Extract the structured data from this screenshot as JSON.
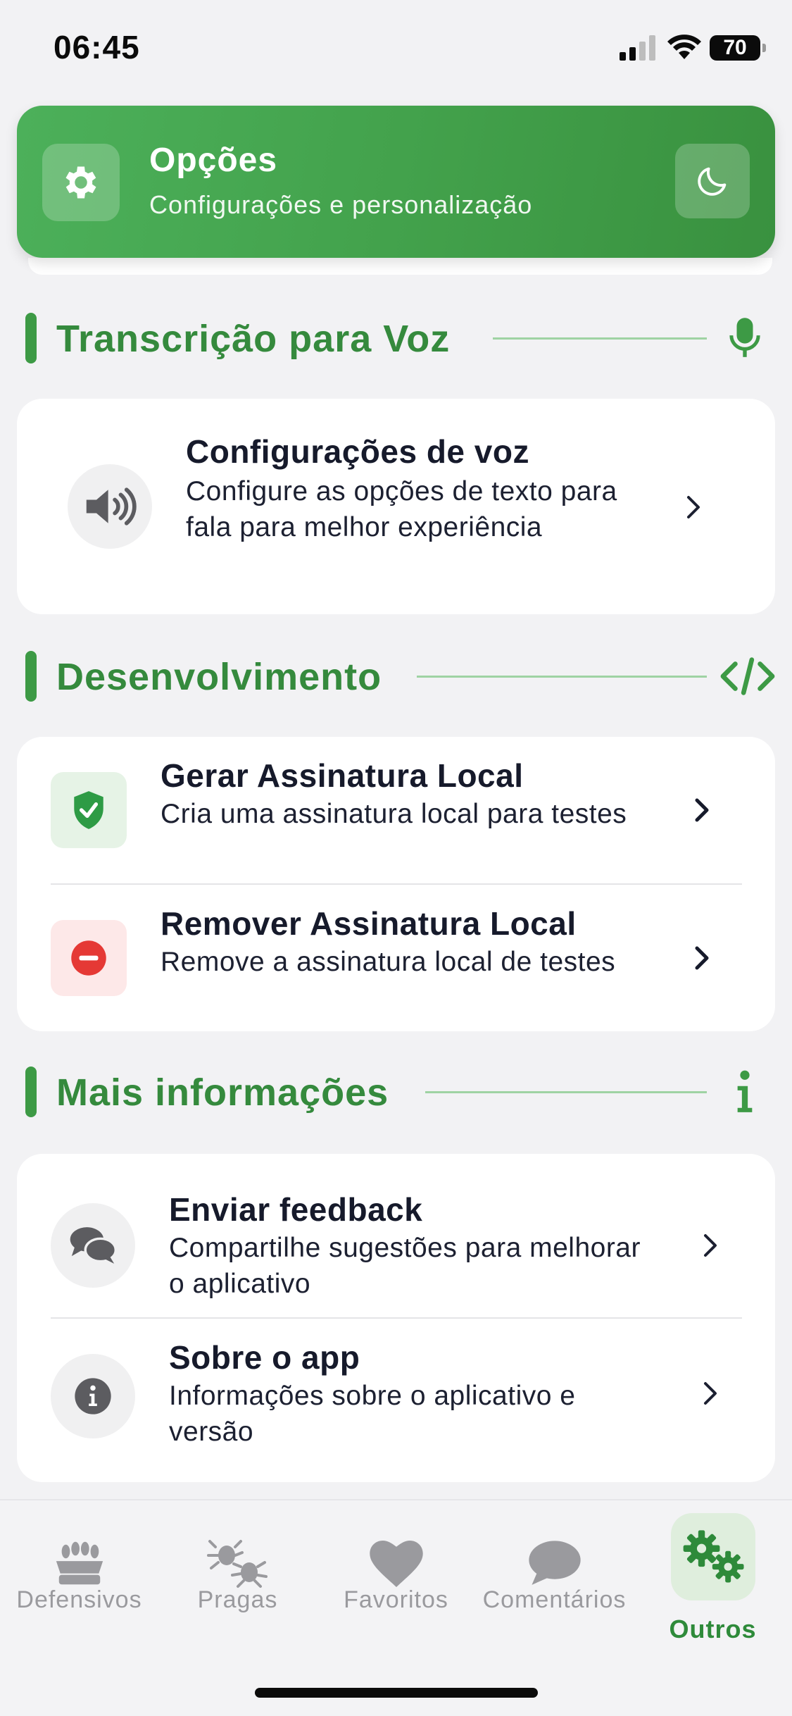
{
  "status_bar": {
    "time": "06:45",
    "battery": "70"
  },
  "header": {
    "title": "Opções",
    "subtitle": "Configurações e personalização"
  },
  "sections": {
    "voice": {
      "title": "Transcrição para Voz",
      "item": {
        "title": "Configurações de voz",
        "description": "Configure as opções de texto para fala para melhor experiência"
      }
    },
    "dev": {
      "title": "Desenvolvimento",
      "items": [
        {
          "title": "Gerar Assinatura Local",
          "description": "Cria uma assinatura local para testes"
        },
        {
          "title": "Remover Assinatura Local",
          "description": "Remove a assinatura local de testes"
        }
      ]
    },
    "info": {
      "title": "Mais informações",
      "items": [
        {
          "title": "Enviar feedback",
          "description": "Compartilhe sugestões para melhorar o aplicativo"
        },
        {
          "title": "Sobre o app",
          "description": "Informações sobre o aplicativo e versão"
        }
      ]
    }
  },
  "bottom_nav": {
    "items": [
      {
        "label": "Defensivos",
        "icon": "sprout-tray-icon"
      },
      {
        "label": "Pragas",
        "icon": "bugs-icon"
      },
      {
        "label": "Favoritos",
        "icon": "heart-icon"
      },
      {
        "label": "Comentários",
        "icon": "comment-icon"
      },
      {
        "label": "Outros",
        "icon": "gears-icon",
        "active": true
      }
    ]
  },
  "colors": {
    "brand_green": "#43a24c",
    "section_green": "#358a3d",
    "danger_red": "#e53935",
    "success_green": "#2e9b45",
    "nav_inactive": "#9a9a9e"
  }
}
